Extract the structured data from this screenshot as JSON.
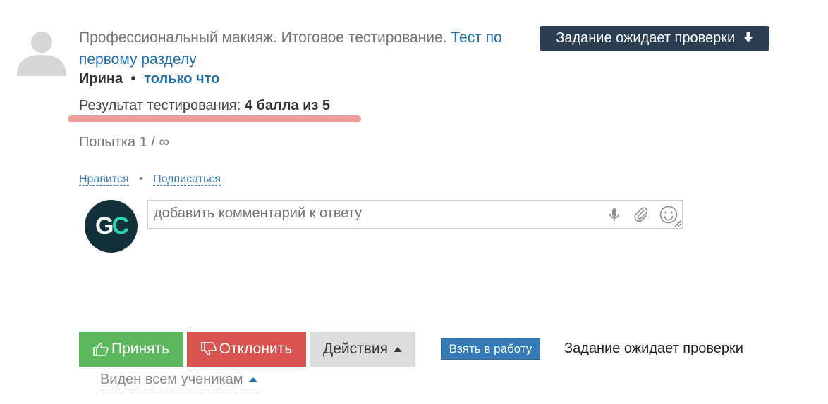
{
  "answer": {
    "title_prefix": "Профессиональный макияж. Итоговое тестирование.",
    "title_link": "Тест по первому разделу",
    "author": "Ирина",
    "bullet": "•",
    "time": "только что",
    "status_badge": "Задание ожидает проверки",
    "result_label": "Результат тестирования:",
    "result_value": "4 балла из 5",
    "attempt": "Попытка 1 / ∞"
  },
  "social": {
    "like": "Нравится",
    "separator": "•",
    "subscribe": "Подписаться"
  },
  "comment": {
    "avatar_letter_g": "G",
    "avatar_letter_c": "C",
    "placeholder": "добавить комментарий к ответу",
    "icons": [
      "microphone-icon",
      "paperclip-icon",
      "smiley-icon"
    ]
  },
  "actions": {
    "accept": "Принять",
    "reject": "Отклонить",
    "more": "Действия",
    "take": "Взять в работу",
    "status_text": "Задание ожидает проверки",
    "visibility": "Виден всем ученикам"
  },
  "colors": {
    "link": "#1f6fae",
    "badge_bg": "#293d53",
    "accept": "#5cb85c",
    "reject": "#d9534f",
    "actions_bg": "#dcdcdc",
    "take": "#337ab7",
    "highlight": "#ef9e9b"
  }
}
